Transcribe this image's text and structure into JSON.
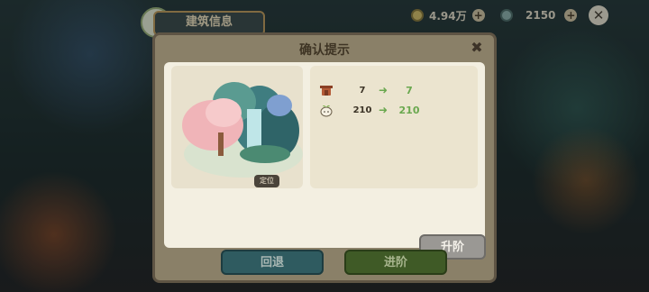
{
  "top_bar": {
    "banner_title": "建筑信息",
    "coins": "4.94万",
    "gems": "2150"
  },
  "dialog": {
    "title": "确认提示",
    "locate_label": "定位",
    "stats": [
      {
        "icon": "lantern-icon",
        "from": "7",
        "to": "7"
      },
      {
        "icon": "sprout-spirit-icon",
        "from": "210",
        "to": "210"
      }
    ],
    "upgrade_label": "升阶",
    "back_label": "回退",
    "advance_label": "进阶"
  },
  "colors": {
    "accent_green": "#6aa84f",
    "dialog_frame": "#8a8068",
    "panel": "#f3efe1"
  }
}
